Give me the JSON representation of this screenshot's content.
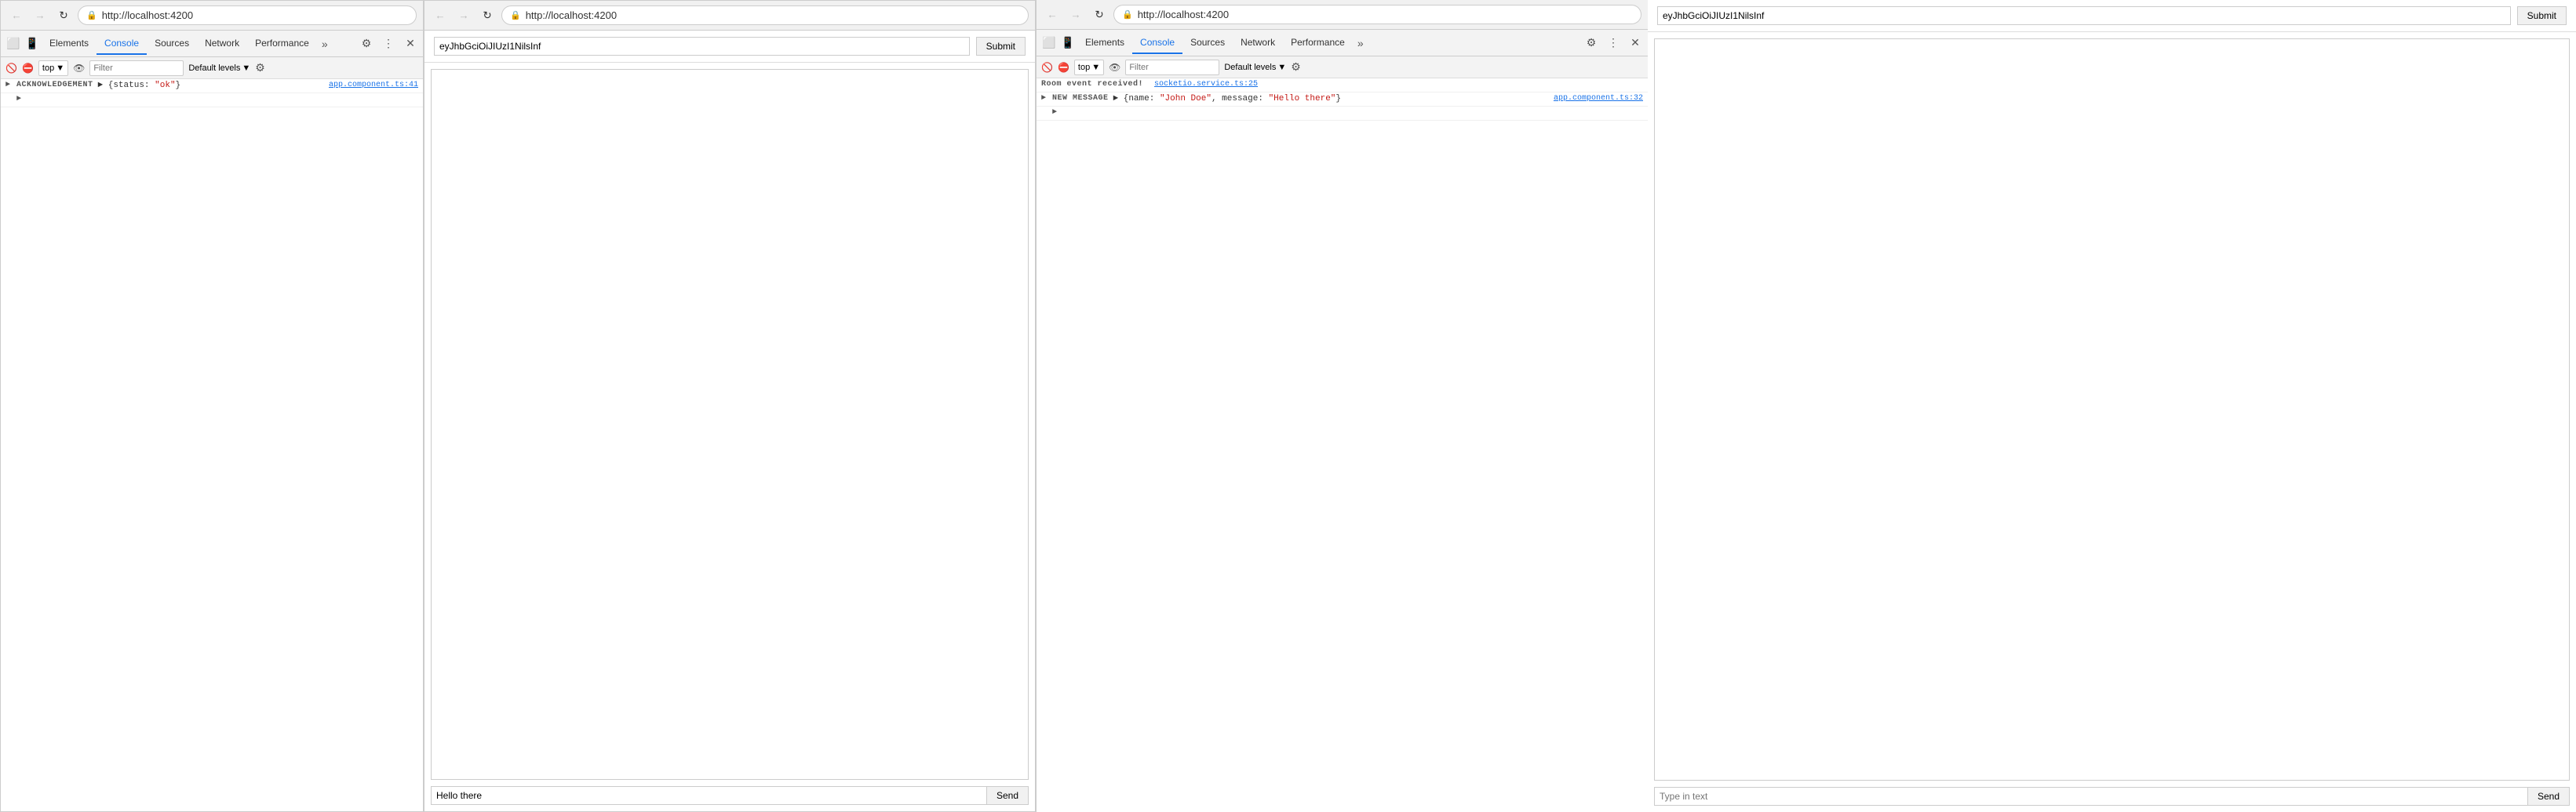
{
  "browser1": {
    "url": "http://localhost:4200",
    "tabs": {
      "elements": "Elements",
      "console": "Console",
      "sources": "Sources",
      "network": "Network",
      "performance": "Performance",
      "more": "»"
    },
    "activeTab": "Console",
    "console": {
      "context": "top",
      "filter_placeholder": "Filter",
      "levels": "Default levels",
      "entries": [
        {
          "label": "ACKNOWLEDGEMENT",
          "expand": true,
          "value": "▶ {status: ",
          "value_string": "\"ok\"",
          "value_end": "}",
          "source": "app.component.ts:41"
        }
      ],
      "expand_arrow": "▶"
    }
  },
  "app1": {
    "url": "http://localhost:4200",
    "token_value": "eyJhbGciOiJIUzI1NilsInf",
    "submit_label": "Submit",
    "chat_input_value": "Hello there",
    "send_label": "Send"
  },
  "browser2": {
    "url": "http://localhost:4200",
    "tabs": {
      "elements": "Elements",
      "console": "Console",
      "sources": "Sources",
      "network": "Network",
      "performance": "Performance",
      "more": "»"
    },
    "activeTab": "Console",
    "console": {
      "context": "top",
      "filter_placeholder": "Filter",
      "levels": "Default levels",
      "entries": [
        {
          "label": "Room event received!",
          "is_plain": true,
          "source": "socketio.service.ts:25"
        },
        {
          "label": "NEW MESSAGE",
          "expand": true,
          "value": "▶ {name: ",
          "name_string": "\"John Doe\"",
          "comma": ", message: ",
          "message_string": "\"Hello there\"",
          "value_end": "}",
          "source": "app.component.ts:32"
        }
      ],
      "expand_arrow": "▶"
    }
  },
  "app2": {
    "url": "http://localhost:4200",
    "token_value": "eyJhbGciOiJIUzI1NilsInf",
    "submit_label": "Submit",
    "chat_input_placeholder": "Type in text",
    "send_label": "Send"
  },
  "icons": {
    "back": "←",
    "forward": "→",
    "reload": "↻",
    "lock": "🔒",
    "clear": "🚫",
    "eye": "👁",
    "settings": "⚙",
    "more_vert": "⋮",
    "close": "✕",
    "dock": "⊞",
    "cursor": "↖",
    "mobile": "📱"
  }
}
